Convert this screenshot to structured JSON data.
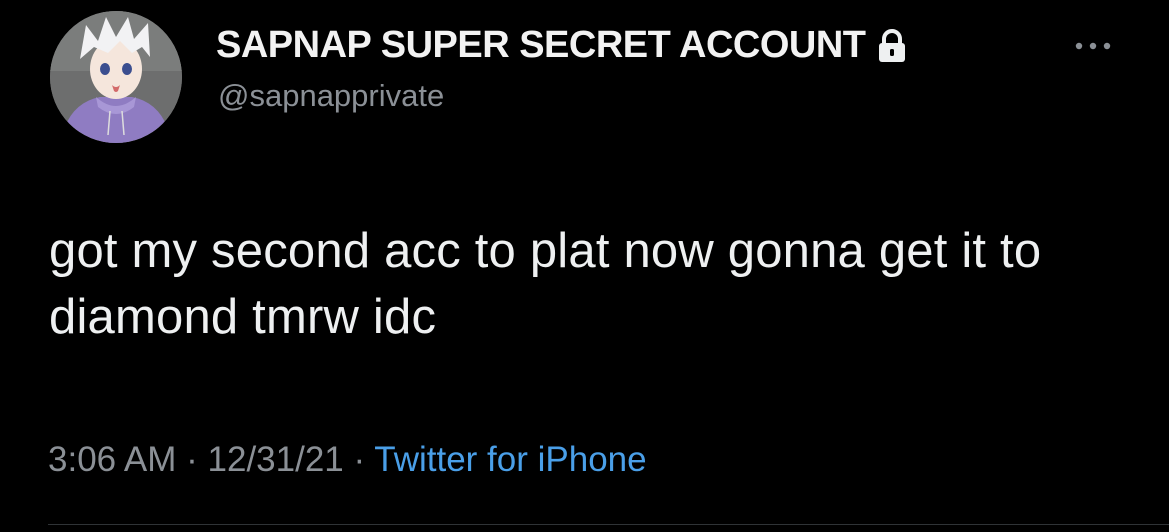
{
  "tweet": {
    "display_name": "SAPNAP SUPER SECRET ACCOUNT",
    "handle": "@sapnapprivate",
    "text": "got my second acc to plat now gonna get it to diamond tmrw idc",
    "time": "3:06 AM",
    "date": "12/31/21",
    "separator": " · ",
    "source": "Twitter for iPhone"
  },
  "icons": {
    "avatar": "avatar-image",
    "lock": "lock-icon",
    "more": "more-options-icon"
  },
  "colors": {
    "background": "#000000",
    "text": "#e7e9ea",
    "muted": "#8b9096",
    "link": "#4a9fe8"
  }
}
